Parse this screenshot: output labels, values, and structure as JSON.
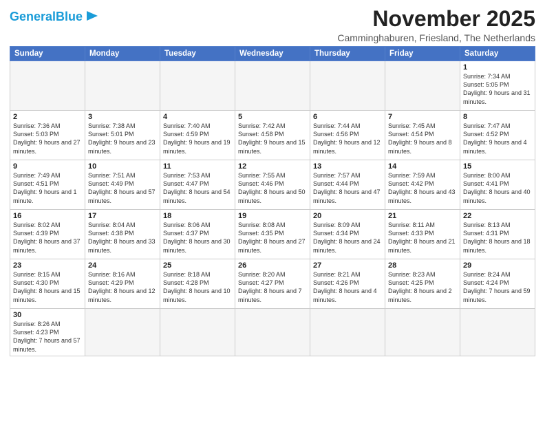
{
  "header": {
    "logo_general": "General",
    "logo_blue": "Blue",
    "month_title": "November 2025",
    "subtitle": "Camminghaburen, Friesland, The Netherlands"
  },
  "days_of_week": [
    "Sunday",
    "Monday",
    "Tuesday",
    "Wednesday",
    "Thursday",
    "Friday",
    "Saturday"
  ],
  "weeks": [
    [
      {
        "day": "",
        "empty": true
      },
      {
        "day": "",
        "empty": true
      },
      {
        "day": "",
        "empty": true
      },
      {
        "day": "",
        "empty": true
      },
      {
        "day": "",
        "empty": true
      },
      {
        "day": "",
        "empty": true
      },
      {
        "day": "1",
        "sunrise": "7:34 AM",
        "sunset": "5:05 PM",
        "daylight": "9 hours and 31 minutes."
      }
    ],
    [
      {
        "day": "2",
        "sunrise": "7:36 AM",
        "sunset": "5:03 PM",
        "daylight": "9 hours and 27 minutes."
      },
      {
        "day": "3",
        "sunrise": "7:38 AM",
        "sunset": "5:01 PM",
        "daylight": "9 hours and 23 minutes."
      },
      {
        "day": "4",
        "sunrise": "7:40 AM",
        "sunset": "4:59 PM",
        "daylight": "9 hours and 19 minutes."
      },
      {
        "day": "5",
        "sunrise": "7:42 AM",
        "sunset": "4:58 PM",
        "daylight": "9 hours and 15 minutes."
      },
      {
        "day": "6",
        "sunrise": "7:44 AM",
        "sunset": "4:56 PM",
        "daylight": "9 hours and 12 minutes."
      },
      {
        "day": "7",
        "sunrise": "7:45 AM",
        "sunset": "4:54 PM",
        "daylight": "9 hours and 8 minutes."
      },
      {
        "day": "8",
        "sunrise": "7:47 AM",
        "sunset": "4:52 PM",
        "daylight": "9 hours and 4 minutes."
      }
    ],
    [
      {
        "day": "9",
        "sunrise": "7:49 AM",
        "sunset": "4:51 PM",
        "daylight": "9 hours and 1 minute."
      },
      {
        "day": "10",
        "sunrise": "7:51 AM",
        "sunset": "4:49 PM",
        "daylight": "8 hours and 57 minutes."
      },
      {
        "day": "11",
        "sunrise": "7:53 AM",
        "sunset": "4:47 PM",
        "daylight": "8 hours and 54 minutes."
      },
      {
        "day": "12",
        "sunrise": "7:55 AM",
        "sunset": "4:46 PM",
        "daylight": "8 hours and 50 minutes."
      },
      {
        "day": "13",
        "sunrise": "7:57 AM",
        "sunset": "4:44 PM",
        "daylight": "8 hours and 47 minutes."
      },
      {
        "day": "14",
        "sunrise": "7:59 AM",
        "sunset": "4:42 PM",
        "daylight": "8 hours and 43 minutes."
      },
      {
        "day": "15",
        "sunrise": "8:00 AM",
        "sunset": "4:41 PM",
        "daylight": "8 hours and 40 minutes."
      }
    ],
    [
      {
        "day": "16",
        "sunrise": "8:02 AM",
        "sunset": "4:39 PM",
        "daylight": "8 hours and 37 minutes."
      },
      {
        "day": "17",
        "sunrise": "8:04 AM",
        "sunset": "4:38 PM",
        "daylight": "8 hours and 33 minutes."
      },
      {
        "day": "18",
        "sunrise": "8:06 AM",
        "sunset": "4:37 PM",
        "daylight": "8 hours and 30 minutes."
      },
      {
        "day": "19",
        "sunrise": "8:08 AM",
        "sunset": "4:35 PM",
        "daylight": "8 hours and 27 minutes."
      },
      {
        "day": "20",
        "sunrise": "8:09 AM",
        "sunset": "4:34 PM",
        "daylight": "8 hours and 24 minutes."
      },
      {
        "day": "21",
        "sunrise": "8:11 AM",
        "sunset": "4:33 PM",
        "daylight": "8 hours and 21 minutes."
      },
      {
        "day": "22",
        "sunrise": "8:13 AM",
        "sunset": "4:31 PM",
        "daylight": "8 hours and 18 minutes."
      }
    ],
    [
      {
        "day": "23",
        "sunrise": "8:15 AM",
        "sunset": "4:30 PM",
        "daylight": "8 hours and 15 minutes."
      },
      {
        "day": "24",
        "sunrise": "8:16 AM",
        "sunset": "4:29 PM",
        "daylight": "8 hours and 12 minutes."
      },
      {
        "day": "25",
        "sunrise": "8:18 AM",
        "sunset": "4:28 PM",
        "daylight": "8 hours and 10 minutes."
      },
      {
        "day": "26",
        "sunrise": "8:20 AM",
        "sunset": "4:27 PM",
        "daylight": "8 hours and 7 minutes."
      },
      {
        "day": "27",
        "sunrise": "8:21 AM",
        "sunset": "4:26 PM",
        "daylight": "8 hours and 4 minutes."
      },
      {
        "day": "28",
        "sunrise": "8:23 AM",
        "sunset": "4:25 PM",
        "daylight": "8 hours and 2 minutes."
      },
      {
        "day": "29",
        "sunrise": "8:24 AM",
        "sunset": "4:24 PM",
        "daylight": "7 hours and 59 minutes."
      }
    ],
    [
      {
        "day": "30",
        "sunrise": "8:26 AM",
        "sunset": "4:23 PM",
        "daylight": "7 hours and 57 minutes."
      },
      {
        "day": "",
        "empty": true
      },
      {
        "day": "",
        "empty": true
      },
      {
        "day": "",
        "empty": true
      },
      {
        "day": "",
        "empty": true
      },
      {
        "day": "",
        "empty": true
      },
      {
        "day": "",
        "empty": true
      }
    ]
  ]
}
